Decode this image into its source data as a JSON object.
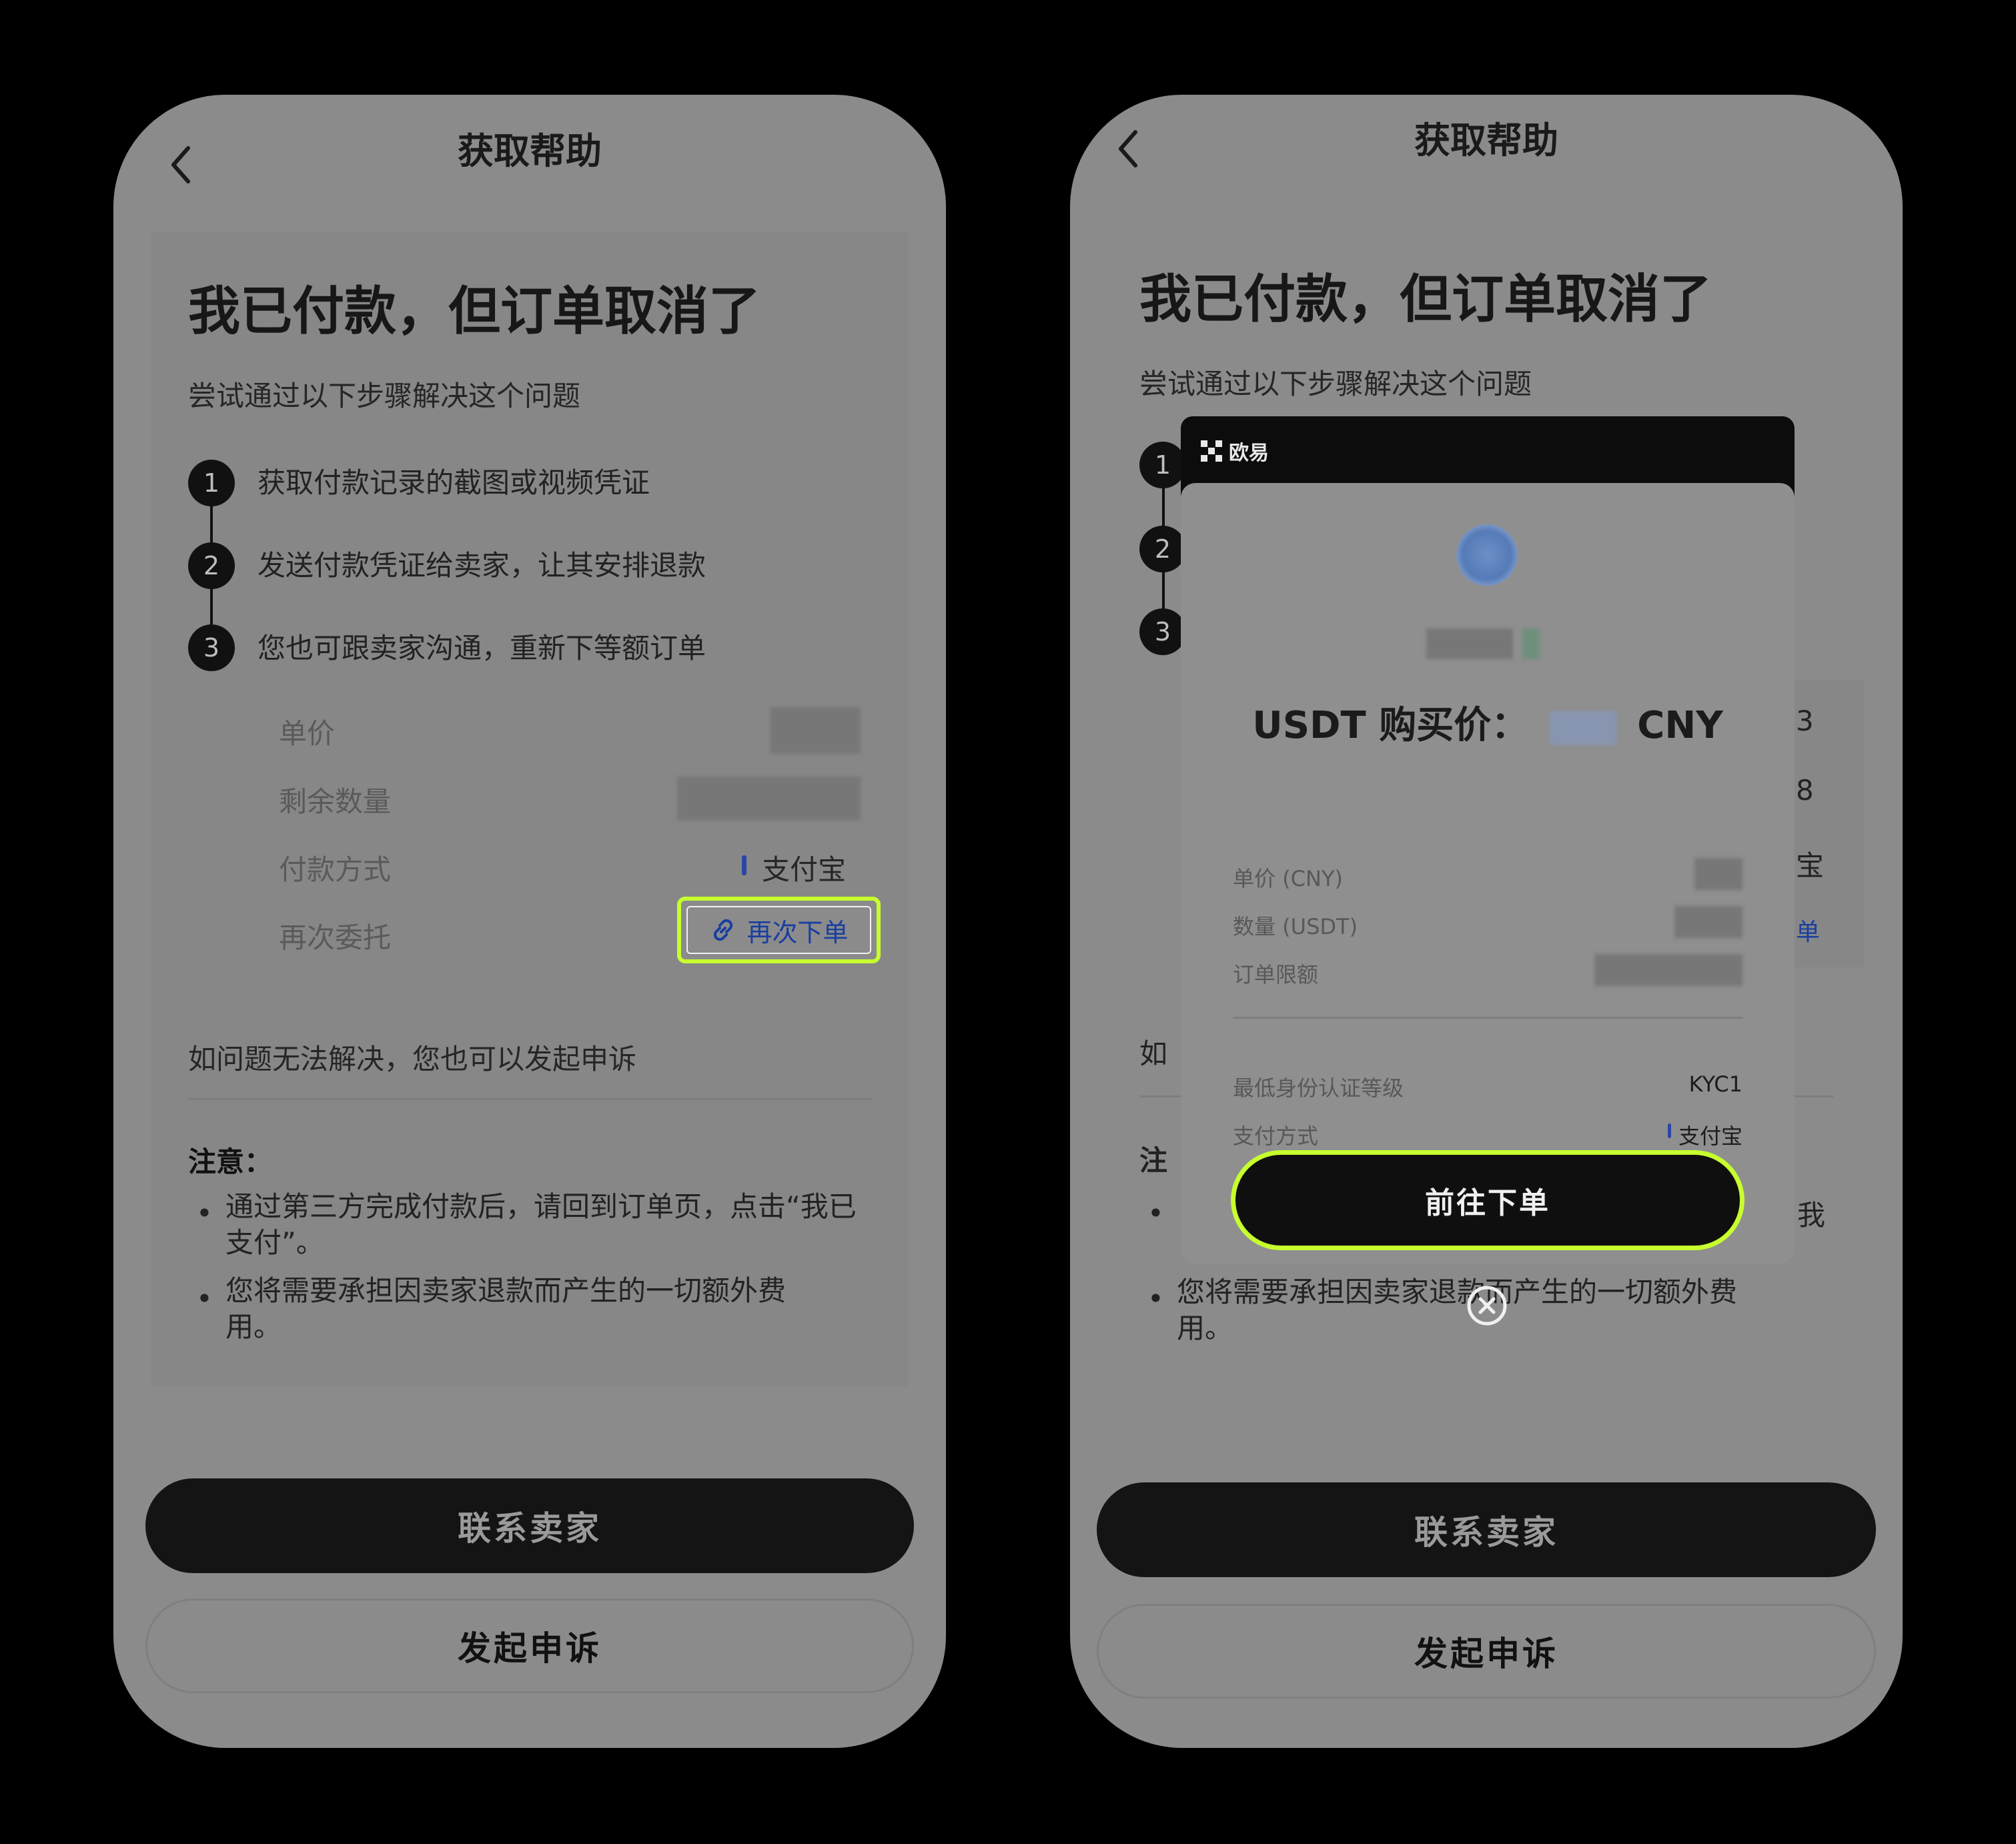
{
  "left": {
    "nav_title": "获取帮助",
    "headline": "我已付款，但订单取消了",
    "subtitle": "尝试通过以下步骤解决这个问题",
    "steps": [
      {
        "num": "1",
        "text": "获取付款记录的截图或视频凭证"
      },
      {
        "num": "2",
        "text": "发送付款凭证给卖家，让其安排退款"
      },
      {
        "num": "3",
        "text": "您也可跟卖家沟通，重新下等额订单"
      }
    ],
    "rows": {
      "unit_price": "单价",
      "remaining": "剩余数量",
      "payment_method": "付款方式",
      "payment_value": "支付宝",
      "reorder_label": "再次委托",
      "reorder_button": "再次下单"
    },
    "appeal_hint": "如问题无法解决，您也可以发起申诉",
    "notice_title": "注意：",
    "notice_items": [
      "通过第三方完成付款后，请回到订单页，点击“我已支付”。",
      "您将需要承担因卖家退款而产生的一切额外费用。"
    ],
    "contact_button": "联系卖家",
    "appeal_button": "发起申诉"
  },
  "right": {
    "nav_title": "获取帮助",
    "headline": "我已付款，但订单取消了",
    "subtitle": "尝试通过以下步骤解决这个问题",
    "steps": [
      "1",
      "2",
      "3"
    ],
    "peek": {
      "r1": "3",
      "r2": "8",
      "r3": "宝",
      "r4": "单",
      "appeal": "如",
      "notice": "注",
      "bullet_end": "我"
    },
    "notice_item_2": "您将需要承担因卖家退款而产生的一切额外费用。",
    "contact_button": "联系卖家",
    "appeal_button": "发起申诉",
    "modal": {
      "brand": "欧易",
      "price_prefix": "USDT 购买价：",
      "price_suffix": "CNY",
      "unit_price": "单价 (CNY)",
      "quantity": "数量 (USDT)",
      "limit": "订单限额",
      "kyc_label": "最低身份认证等级",
      "kyc_value": "KYC1",
      "pay_label": "支付方式",
      "pay_value": "支付宝",
      "goto_button": "前往下单"
    }
  },
  "colors": {
    "highlight": "#c8ff2e",
    "alipay_bar": "#2b44a6",
    "link_blue": "#1a3ea0"
  },
  "icons": [
    "back-arrow-icon",
    "link-icon",
    "okx-logo-icon",
    "close-circle-icon"
  ]
}
